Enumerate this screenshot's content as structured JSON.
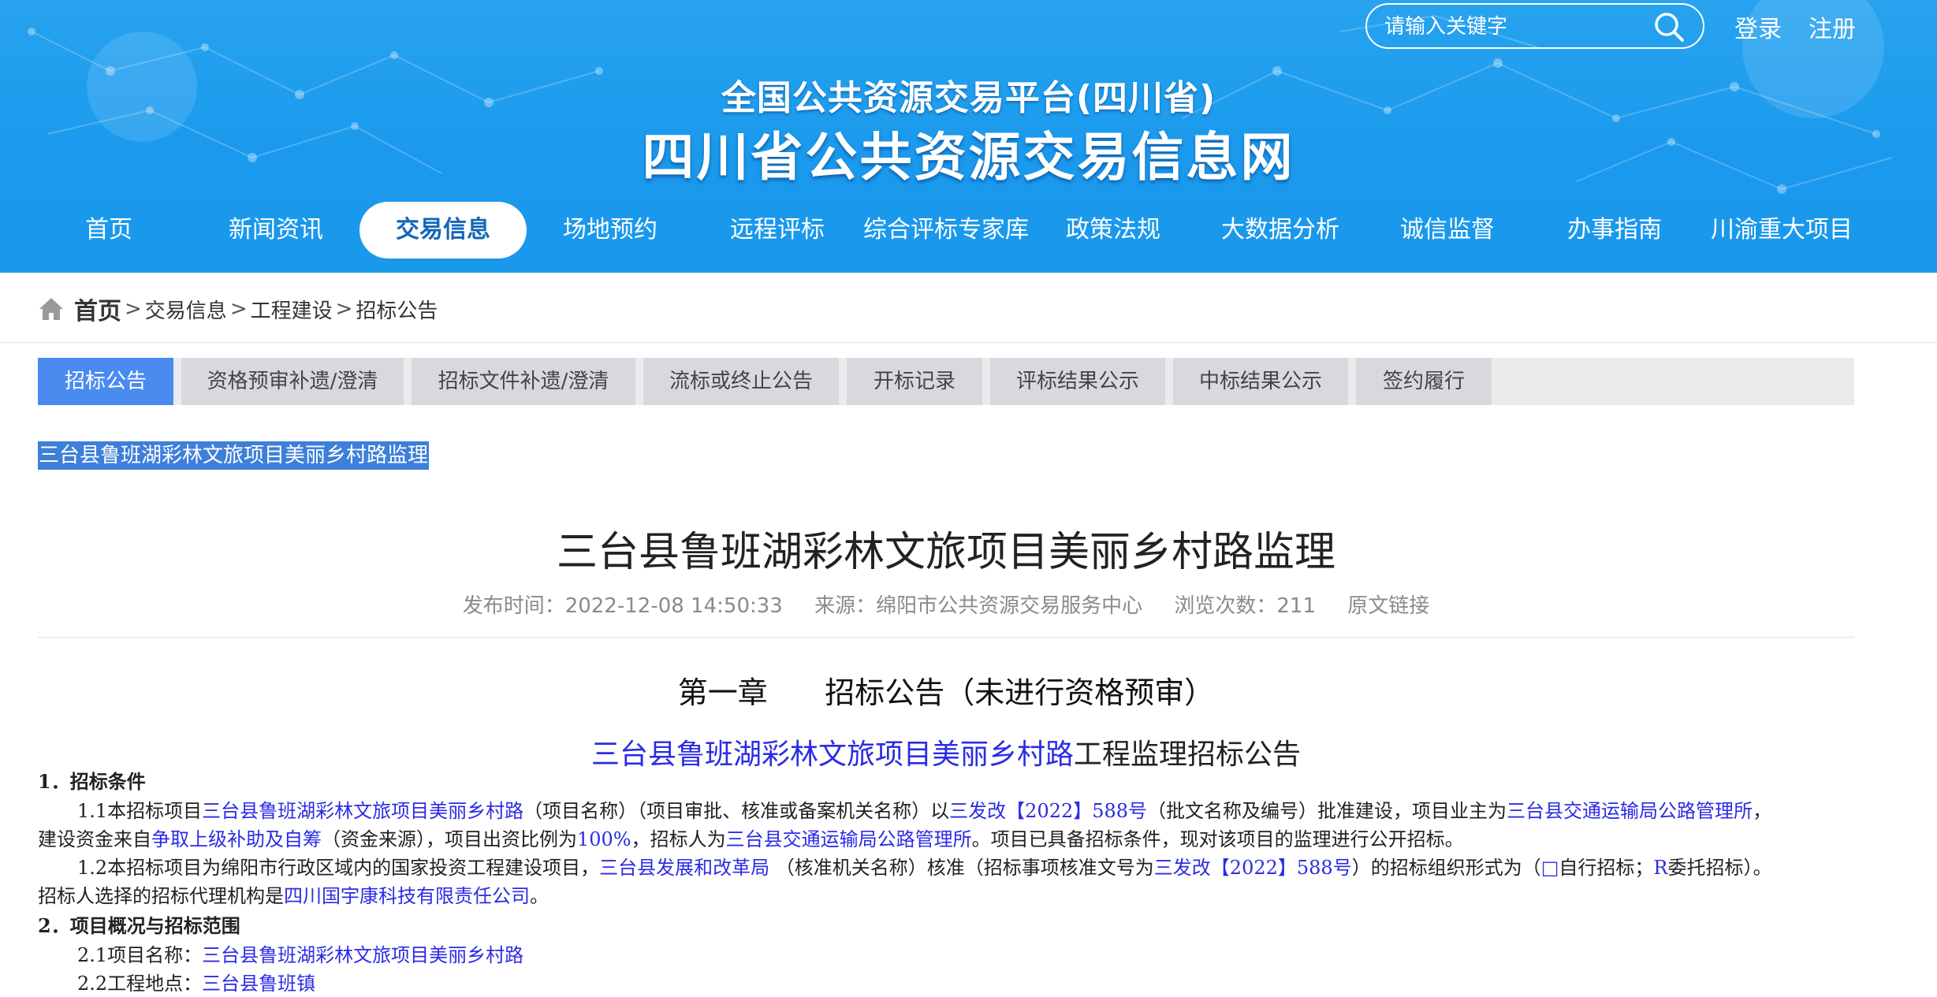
{
  "search": {
    "placeholder": "请输入关键字"
  },
  "header": {
    "login": "登录",
    "register": "注册",
    "subtitle": "全国公共资源交易平台(四川省)",
    "title": "四川省公共资源交易信息网"
  },
  "nav": [
    {
      "label": "首页",
      "active": false
    },
    {
      "label": "新闻资讯",
      "active": false
    },
    {
      "label": "交易信息",
      "active": true
    },
    {
      "label": "场地预约",
      "active": false
    },
    {
      "label": "远程评标",
      "active": false
    },
    {
      "label": "综合评标专家库",
      "active": false
    },
    {
      "label": "政策法规",
      "active": false
    },
    {
      "label": "大数据分析",
      "active": false
    },
    {
      "label": "诚信监督",
      "active": false
    },
    {
      "label": "办事指南",
      "active": false
    },
    {
      "label": "川渝重大项目",
      "active": false
    }
  ],
  "breadcrumb": {
    "home": "首页",
    "items": [
      "交易信息",
      "工程建设",
      "招标公告"
    ],
    "sep": ">"
  },
  "tabs": [
    {
      "label": "招标公告",
      "active": true
    },
    {
      "label": "资格预审补遗/澄清",
      "active": false
    },
    {
      "label": "招标文件补遗/澄清",
      "active": false
    },
    {
      "label": "流标或终止公告",
      "active": false
    },
    {
      "label": "开标记录",
      "active": false
    },
    {
      "label": "评标结果公示",
      "active": false
    },
    {
      "label": "中标结果公示",
      "active": false
    },
    {
      "label": "签约履行",
      "active": false
    }
  ],
  "snippet": "三台县鲁班湖彩林文旅项目美丽乡村路监理",
  "article": {
    "title": "三台县鲁班湖彩林文旅项目美丽乡村路监理",
    "publish_time": "发布时间：2022-12-08 14:50:33",
    "source": "来源：绵阳市公共资源交易服务中心",
    "views": "浏览次数：211",
    "original_link": "原文链接"
  },
  "content": {
    "chapter": "第一章      招标公告（未进行资格预审）",
    "notice_title_project": "三台县鲁班湖彩林文旅项目美丽乡村路",
    "notice_title_rest": "工程监理招标公告",
    "s1_heading": "1．招标条件",
    "p1_1": {
      "t1": "1.1本招标项目",
      "b1": "三台县鲁班湖彩林文旅项目美丽乡村路",
      "t2": "（项目名称）（项目审批、核准或备案机关名称）以",
      "b2": "三发改【2022】588号",
      "t3": "（批文名称及编号）批准建设，项目业主为",
      "b3": "三台县交通运输局公路管理所",
      "t4": "，"
    },
    "p1_1b": {
      "t1": "建设资金来自",
      "b1": "争取上级补助及自筹",
      "t2": "（资金来源），项目出资比例为",
      "b2": "100%",
      "t3": "，招标人为",
      "b3": "三台县交通运输局公路管理所",
      "t4": "。项目已具备招标条件，现对该项目的监理进行公开招标。"
    },
    "p1_2": {
      "t1": "1.2本招标项目为绵阳市行政区域内的国家投资工程建设项目，",
      "b1": "三台县发展和改革局",
      "t2": " （核准机关名称）核准（招标事项核准文号为",
      "b2": "三发改【2022】588号",
      "t3": "）的招标组织形式为（",
      "b3": "□",
      "t4": "自行招标；",
      "b4": "R",
      "t5": "委托招标）。"
    },
    "p1_2b": {
      "t1": "招标人选择的招标代理机构是",
      "b1": "四川国宇康科技有限责任公司",
      "t2": "。"
    },
    "s2_heading": "2．项目概况与招标范围",
    "p2_1": {
      "t1": "2.1项目名称：",
      "b1": "三台县鲁班湖彩林文旅项目美丽乡村路"
    },
    "p2_2": {
      "t1": "2.2工程地点：",
      "b1": "三台县鲁班镇"
    }
  }
}
